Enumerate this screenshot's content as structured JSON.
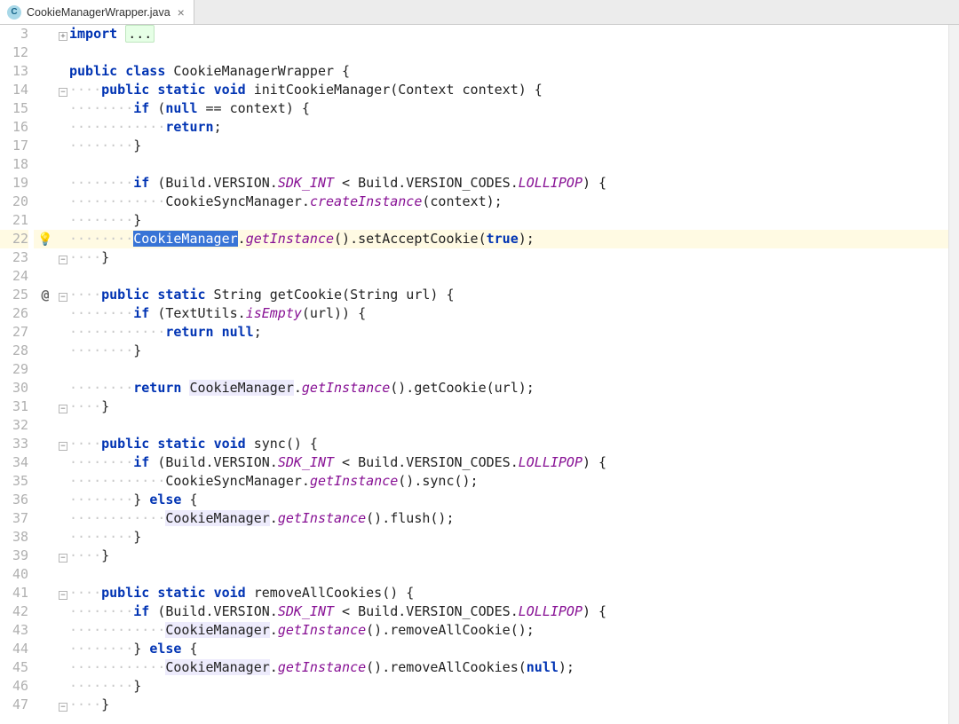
{
  "tab": {
    "filename": "CookieManagerWrapper.java",
    "icon_letter": "C"
  },
  "gutter": {
    "line_numbers": [
      "3",
      "12",
      "13",
      "14",
      "15",
      "16",
      "17",
      "18",
      "19",
      "20",
      "21",
      "22",
      "23",
      "24",
      "25",
      "26",
      "27",
      "28",
      "29",
      "30",
      "31",
      "32",
      "33",
      "34",
      "35",
      "36",
      "37",
      "38",
      "39",
      "40",
      "41",
      "42",
      "43",
      "44",
      "45",
      "46",
      "47"
    ],
    "marks": [
      "",
      "",
      "",
      "",
      "",
      "",
      "",
      "",
      "",
      "",
      "",
      "",
      "",
      "",
      "@",
      "",
      "",
      "",
      "",
      "",
      "",
      "",
      "",
      "",
      "",
      "",
      "",
      "",
      "",
      "",
      "",
      "",
      "",
      "",
      "",
      "",
      ""
    ]
  },
  "fold": {
    "glyph_plus": "+",
    "glyph_start": "−",
    "glyph_end": "−"
  },
  "code": {
    "l3_kw1": "import",
    "l3_ellipsis": "...",
    "l13_kw1": "public",
    "l13_kw2": "class",
    "l13_rest": " CookieManagerWrapper {",
    "l14_kw1": "public",
    "l14_kw2": "static",
    "l14_kw3": "void",
    "l14_rest": " initCookieManager(Context context) {",
    "l15_kw1": "if",
    "l15_a": " (",
    "l15_kw2": "null",
    "l15_b": " == context) {",
    "l16_kw1": "return",
    "l16_b": ";",
    "l17": "}",
    "l19_kw1": "if",
    "l19_a": " (Build.VERSION.",
    "l19_st": "SDK_INT",
    "l19_b": " < Build.VERSION_CODES.",
    "l19_st2": "LOLLIPOP",
    "l19_c": ") {",
    "l20_a": "CookieSyncManager.",
    "l20_m": "createInstance",
    "l20_b": "(context);",
    "l21": "}",
    "l22_sel": "CookieManager",
    "l22_a": ".",
    "l22_m": "getInstance",
    "l22_b": "().setAcceptCookie(",
    "l22_bool": "true",
    "l22_c": ");",
    "l23": "}",
    "l25_kw1": "public",
    "l25_kw2": "static",
    "l25_rest": " String getCookie(String url) {",
    "l26_kw1": "if",
    "l26_a": " (TextUtils.",
    "l26_m": "isEmpty",
    "l26_b": "(url)) {",
    "l27_kw1": "return",
    "l27_a": " ",
    "l27_kw2": "null",
    "l27_b": ";",
    "l28": "}",
    "l30_kw1": "return",
    "l30_a": " ",
    "l30_hl": "CookieManager",
    "l30_b": ".",
    "l30_m": "getInstance",
    "l30_c": "().getCookie(url);",
    "l31": "}",
    "l33_kw1": "public",
    "l33_kw2": "static",
    "l33_kw3": "void",
    "l33_rest": " sync() {",
    "l34_kw1": "if",
    "l34_a": " (Build.VERSION.",
    "l34_st": "SDK_INT",
    "l34_b": " < Build.VERSION_CODES.",
    "l34_st2": "LOLLIPOP",
    "l34_c": ") {",
    "l35_a": "CookieSyncManager.",
    "l35_m": "getInstance",
    "l35_b": "().sync();",
    "l36_a": "} ",
    "l36_kw1": "else",
    "l36_b": " {",
    "l37_hl": "CookieManager",
    "l37_a": ".",
    "l37_m": "getInstance",
    "l37_b": "().flush();",
    "l38": "}",
    "l39": "}",
    "l41_kw1": "public",
    "l41_kw2": "static",
    "l41_kw3": "void",
    "l41_rest": " removeAllCookies() {",
    "l42_kw1": "if",
    "l42_a": " (Build.VERSION.",
    "l42_st": "SDK_INT",
    "l42_b": " < Build.VERSION_CODES.",
    "l42_st2": "LOLLIPOP",
    "l42_c": ") {",
    "l43_hl": "CookieManager",
    "l43_a": ".",
    "l43_m": "getInstance",
    "l43_b": "().removeAllCookie();",
    "l44_a": "} ",
    "l44_kw1": "else",
    "l44_b": " {",
    "l45_hl": "CookieManager",
    "l45_a": ".",
    "l45_m": "getInstance",
    "l45_b": "().removeAllCookies(",
    "l45_kw": "null",
    "l45_c": ");",
    "l46": "}",
    "l47": "}"
  },
  "indent": {
    "d1": "····",
    "d2": "········",
    "d3": "············",
    "d4": "················"
  },
  "icons": {
    "bulb": "💡"
  }
}
